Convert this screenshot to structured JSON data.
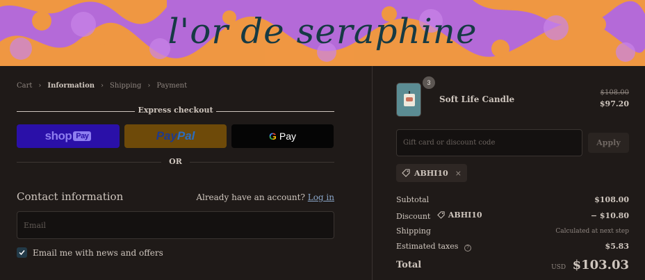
{
  "brand": {
    "name": "l'or de seraphine"
  },
  "colors": {
    "banner_purple": "#b46ad8",
    "banner_orange": "#f39a3a",
    "brand_ink": "#163a44",
    "background": "#1f1a18"
  },
  "breadcrumb": {
    "items": [
      "Cart",
      "Information",
      "Shipping",
      "Payment"
    ],
    "separator": "›",
    "active": "Information"
  },
  "express": {
    "label": "Express checkout",
    "shop": {
      "text": "shop",
      "badge": "Pay"
    },
    "paypal": {
      "part1": "Pay",
      "part2": "Pal"
    },
    "gpay": {
      "g": "G",
      "text": "Pay"
    },
    "or_label": "OR"
  },
  "contact": {
    "title": "Contact information",
    "account_prompt": "Already have an account?",
    "login_link": "Log in",
    "email_placeholder": "Email",
    "newsletter_label": "Email me with news and offers",
    "newsletter_checked": true
  },
  "cart": {
    "item": {
      "name": "Soft Life Candle",
      "quantity": "3",
      "price_original": "$108.00",
      "price_discounted": "$97.20"
    },
    "discount_input_placeholder": "Gift card or discount code",
    "apply_label": "Apply",
    "applied_code": "ABHI10",
    "remove_symbol": "×"
  },
  "summary": {
    "subtotal_label": "Subtotal",
    "subtotal_value": "$108.00",
    "discount_label": "Discount",
    "discount_code": "ABHI10",
    "discount_value": "− $10.80",
    "shipping_label": "Shipping",
    "shipping_value": "Calculated at next step",
    "taxes_label": "Estimated taxes",
    "taxes_info": "?",
    "taxes_value": "$5.83",
    "total_label": "Total",
    "currency": "USD",
    "total_value": "$103.03"
  }
}
